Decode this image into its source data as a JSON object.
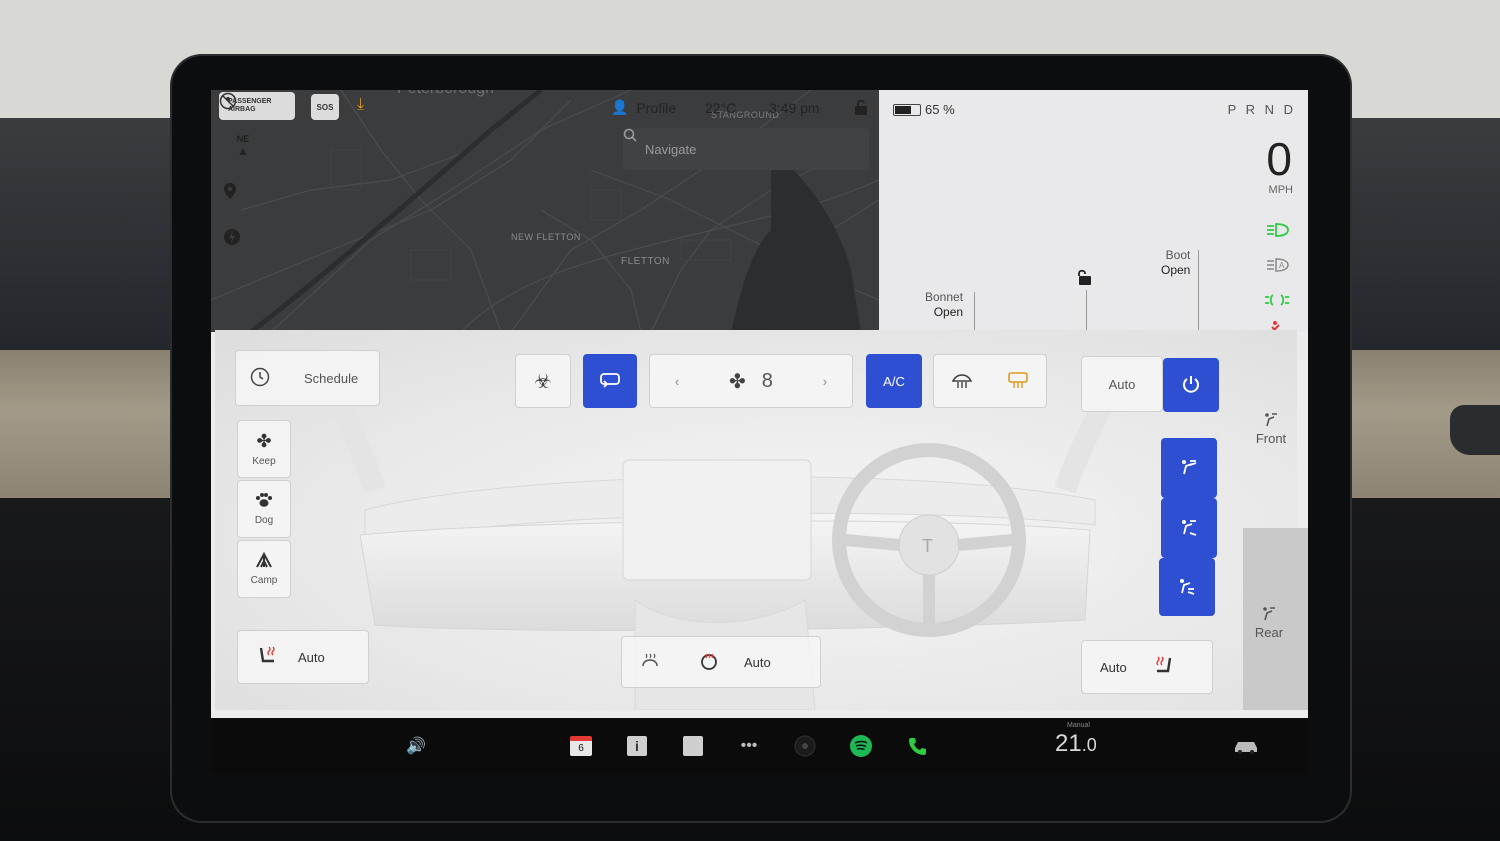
{
  "status_bar": {
    "airbag_line1": "PASSENGER",
    "airbag_line2": "AIRBAG",
    "sos_label": "SOS",
    "profile_label": "Profile",
    "temperature": "22°C",
    "time": "3:49 pm",
    "battery_percent": "65 %",
    "battery_level": 0.65
  },
  "map": {
    "city_label": "Peterborough",
    "compass_label": "NE",
    "area_labels": [
      "NEW FLETTON",
      "FLETTON",
      "STANGROUND"
    ],
    "search_placeholder": "Navigate"
  },
  "vehicle": {
    "gear": "P R N D",
    "speed": "0",
    "speed_unit": "MPH",
    "boot_label": "Boot",
    "boot_state": "Open",
    "bonnet_label": "Bonnet",
    "bonnet_state": "Open",
    "indicator_colors": {
      "lights": "#2ecc40",
      "auto_high": "#888888",
      "side_lights": "#2ecc40",
      "seatbelt": "#e53935"
    }
  },
  "climate": {
    "schedule_label": "Schedule",
    "modes": [
      {
        "label": "Keep",
        "icon": "fan-icon"
      },
      {
        "label": "Dog",
        "icon": "paw-icon"
      },
      {
        "label": "Camp",
        "icon": "tent-icon"
      }
    ],
    "fan_speed": "8",
    "ac_label": "A/C",
    "auto_label": "Auto",
    "left_seat_auto": "Auto",
    "center_auto": "Auto",
    "right_seat_auto": "Auto",
    "front_label": "Front",
    "rear_label": "Rear",
    "accent_color": "#2f4fd3"
  },
  "taskbar": {
    "calendar_day": "6",
    "info_label": "i",
    "cabin_temp_whole": "21",
    "cabin_temp_decimal": ".0",
    "temp_mode": "Manual"
  }
}
